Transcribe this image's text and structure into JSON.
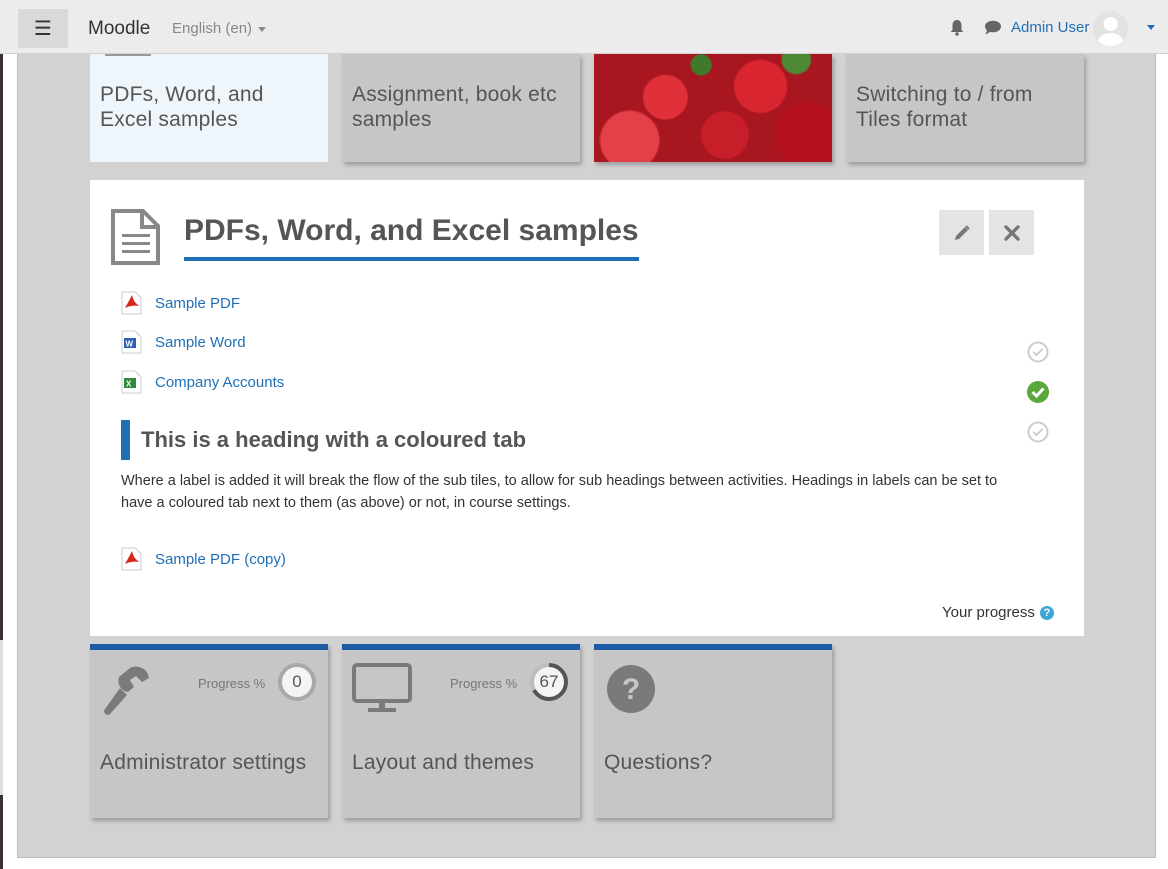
{
  "navbar": {
    "brand": "Moodle",
    "language": "English (en)",
    "username": "Admin User"
  },
  "top_tiles": [
    {
      "title_line1": "PDFs, Word, and",
      "title_line2": "Excel samples",
      "state": "active"
    },
    {
      "title_line1": "Assignment, book etc",
      "title_line2": "samples"
    },
    {
      "image": "strawberries"
    },
    {
      "title_line1": "Switching to / from",
      "title_line2": "Tiles format"
    }
  ],
  "panel": {
    "title": "PDFs, Word, and Excel samples",
    "activities": [
      {
        "label": "Sample PDF",
        "icon": "pdf-file-icon",
        "completion": "none"
      },
      {
        "label": "Sample Word",
        "icon": "word-file-icon",
        "completion": "incomplete"
      },
      {
        "label": "Company Accounts",
        "icon": "excel-file-icon",
        "completion": "complete"
      }
    ],
    "heading": "This is a heading with a coloured tab",
    "label_text": "Where a label is added it will break the flow of the sub tiles, to allow for sub headings between activities.  Headings in labels can be set to have a coloured tab next to them (as above) or not, in course settings.",
    "extra_activity": {
      "label": "Sample PDF (copy)",
      "icon": "pdf-file-icon"
    },
    "progress_label": "Your progress",
    "help_glyph": "?",
    "colors": {
      "accent": "#1f6fb5",
      "complete": "#5aa83c",
      "incomplete": "#cccccc"
    }
  },
  "bottom_tiles": [
    {
      "title": "Administrator settings",
      "icon": "wrench-icon",
      "progress_label": "Progress %",
      "progress": "0",
      "progress_fraction": 0
    },
    {
      "title": "Layout and themes",
      "icon": "monitor-icon",
      "progress_label": "Progress %",
      "progress": "67",
      "progress_fraction": 0.67
    },
    {
      "title": "Questions?",
      "icon": "question-circle-icon"
    }
  ]
}
